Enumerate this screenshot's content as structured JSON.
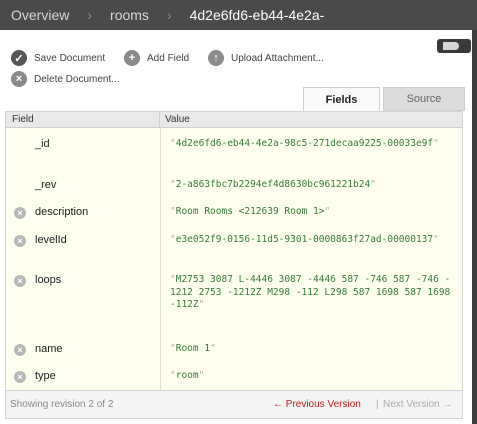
{
  "breadcrumb": {
    "items": [
      "Overview",
      "rooms",
      "4d2e6fd6-eb44-4e2a-"
    ],
    "separator": "›"
  },
  "toolbar": {
    "save_label": "Save Document",
    "add_field_label": "Add Field",
    "upload_label": "Upload Attachment...",
    "delete_label": "Delete Document..."
  },
  "tabs": {
    "fields": "Fields",
    "source": "Source",
    "active": "Fields"
  },
  "table": {
    "headers": {
      "field": "Field",
      "value": "Value"
    },
    "rows": [
      {
        "name": "_id",
        "value": "4d2e6fd6-eb44-4e2a-98c5-271decaa9225-00033e9f",
        "deletable": false
      },
      {
        "name": "_rev",
        "value": "2-a863fbc7b2294ef4d8630bc961221b24",
        "deletable": false
      },
      {
        "name": "description",
        "value": "Room Rooms <212639 Room 1>",
        "deletable": true
      },
      {
        "name": "levelId",
        "value": "e3e052f9-0156-11d5-9301-0000863f27ad-00000137",
        "deletable": true
      },
      {
        "name": "loops",
        "value": "M2753 3087 L-4446 3087 -4446 587 -746 587 -746 -1212 2753 -1212Z M298 -112 L298 587 1698 587 1698 -112Z",
        "deletable": true
      },
      {
        "name": "name",
        "value": "Room 1",
        "deletable": true
      },
      {
        "name": "type",
        "value": "room",
        "deletable": true
      }
    ]
  },
  "footer": {
    "revision": "Showing revision 2 of 2",
    "previous": "← Previous Version",
    "separator": "|",
    "next": "Next Version →"
  },
  "colors": {
    "topbar": "#4a4a4a",
    "value_text": "#3a7a3a",
    "previous_link": "#bb2222"
  }
}
